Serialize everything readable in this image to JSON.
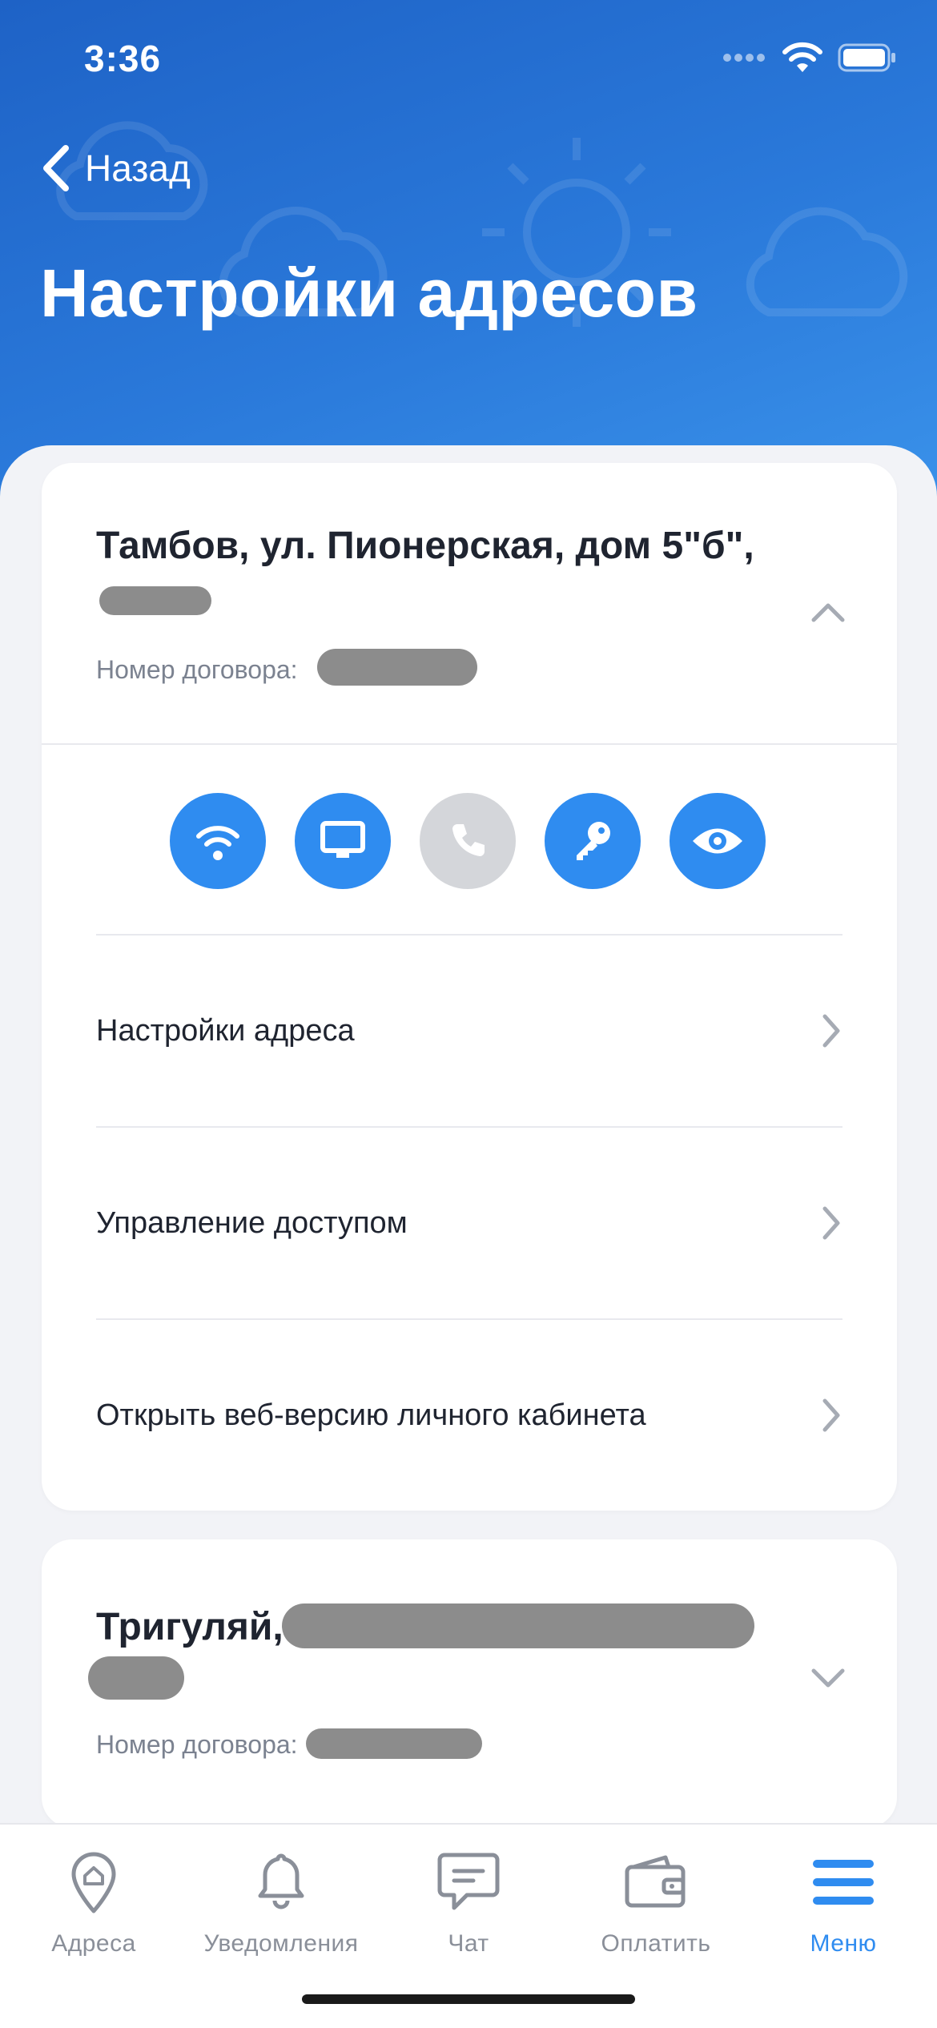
{
  "status_bar": {
    "time": "3:36"
  },
  "nav": {
    "back_label": "Назад",
    "title": "Настройки адресов"
  },
  "addresses": [
    {
      "title": "Тамбов, ул. Пионерская, дом 5\"б\",",
      "contract_label": "Номер договора:",
      "expanded": true,
      "services": [
        {
          "icon": "wifi-icon",
          "enabled": true
        },
        {
          "icon": "tv-icon",
          "enabled": true
        },
        {
          "icon": "phone-icon",
          "enabled": false
        },
        {
          "icon": "key-icon",
          "enabled": true
        },
        {
          "icon": "eye-icon",
          "enabled": true
        }
      ],
      "menu": [
        {
          "label": "Настройки адреса"
        },
        {
          "label": "Управление доступом"
        },
        {
          "label": "Открыть веб-версию личного кабинета"
        }
      ]
    },
    {
      "title": "Тригуляй,",
      "contract_label": "Номер договора:",
      "expanded": false
    }
  ],
  "tabbar": {
    "items": [
      {
        "label": "Адреса",
        "icon": "address-pin-icon",
        "active": false
      },
      {
        "label": "Уведомления",
        "icon": "bell-icon",
        "active": false
      },
      {
        "label": "Чат",
        "icon": "chat-icon",
        "active": false
      },
      {
        "label": "Оплатить",
        "icon": "wallet-icon",
        "active": false
      },
      {
        "label": "Меню",
        "icon": "menu-icon",
        "active": true
      }
    ]
  },
  "colors": {
    "accent": "#2f8cf0",
    "header_top": "#1e62c6",
    "header_bottom": "#3a92ea",
    "disabled": "#d4d6da"
  }
}
